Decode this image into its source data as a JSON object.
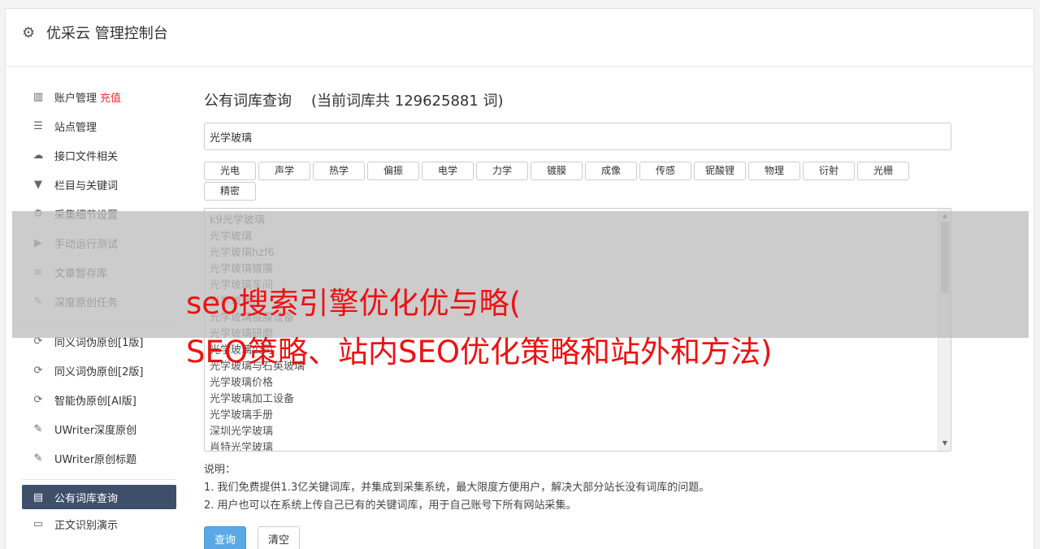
{
  "app": {
    "title": "优采云 管理控制台"
  },
  "sidebar": {
    "group1": [
      {
        "label": "账户管理",
        "extra": "充值",
        "icon": "bar-chart-icon",
        "glyph": "▥"
      },
      {
        "label": "站点管理",
        "icon": "server-icon",
        "glyph": "☰"
      },
      {
        "label": "接口文件相关",
        "icon": "cloud-upload-icon",
        "glyph": "☁"
      },
      {
        "label": "栏目与关键词",
        "icon": "filter-icon",
        "glyph": "▼"
      },
      {
        "label": "采集细节设置",
        "icon": "gears-icon",
        "glyph": "⚙"
      },
      {
        "label": "手动运行测试",
        "icon": "play-circle-icon",
        "glyph": "▶"
      },
      {
        "label": "文章暂存库",
        "icon": "database-icon",
        "glyph": "≡"
      },
      {
        "label": "深度原创任务",
        "icon": "edit-icon",
        "glyph": "✎"
      }
    ],
    "group2": [
      {
        "label": "同义词伪原创[1版]",
        "icon": "refresh-icon",
        "glyph": "⟳"
      },
      {
        "label": "同义词伪原创[2版]",
        "icon": "refresh-icon",
        "glyph": "⟳"
      },
      {
        "label": "智能伪原创[AI版]",
        "icon": "refresh-icon",
        "glyph": "⟳"
      },
      {
        "label": "UWriter深度原创",
        "icon": "edit-icon",
        "glyph": "✎"
      },
      {
        "label": "UWriter原创标题",
        "icon": "edit-icon",
        "glyph": "✎"
      }
    ],
    "group3": [
      {
        "label": "公有词库查询",
        "icon": "book-icon",
        "glyph": "▤",
        "active": true
      },
      {
        "label": "正文识别演示",
        "icon": "desktop-icon",
        "glyph": "▭"
      }
    ]
  },
  "main": {
    "title": "公有词库查询",
    "count_text": "(当前词库共 129625881 词)",
    "search_value": "光学玻璃",
    "tags": [
      "光电",
      "声学",
      "热学",
      "偏振",
      "电学",
      "力学",
      "镀膜",
      "成像",
      "传感",
      "铌酸锂",
      "物理",
      "衍射",
      "光栅",
      "精密"
    ],
    "results": [
      "k9光学玻璃",
      "光学玻璃",
      "光学玻璃hzf6",
      "光学玻璃镀膜",
      "光学玻璃车间",
      "光学玻璃厂",
      "光学玻璃镀膜设备",
      "光学玻璃研磨",
      "光学玻璃公司",
      "光学玻璃与石英玻璃",
      "光学玻璃价格",
      "光学玻璃加工设备",
      "光学玻璃手册",
      "深圳光学玻璃",
      "肖特光学玻璃"
    ],
    "notes": [
      "说明：",
      "1. 我们免费提供1.3亿关键词库，并集成到采集系统，最大限度方便用户，解决大部分站长没有词库的问题。",
      "2. 用户也可以在系统上传自己已有的关键词库，用于自己账号下所有网站采集。"
    ],
    "buttons": {
      "query": "查询",
      "clear": "清空"
    }
  },
  "overlay": {
    "line1": "seo搜索引擎优化优与略(",
    "line2": "SEO策略、站内SEO优化策略和站外和方法)"
  },
  "colors": {
    "active_nav": "#3e4f6a",
    "primary_button": "#5aa9e6",
    "overlay_text": "#ee1111",
    "recharge": "#ee3333"
  }
}
